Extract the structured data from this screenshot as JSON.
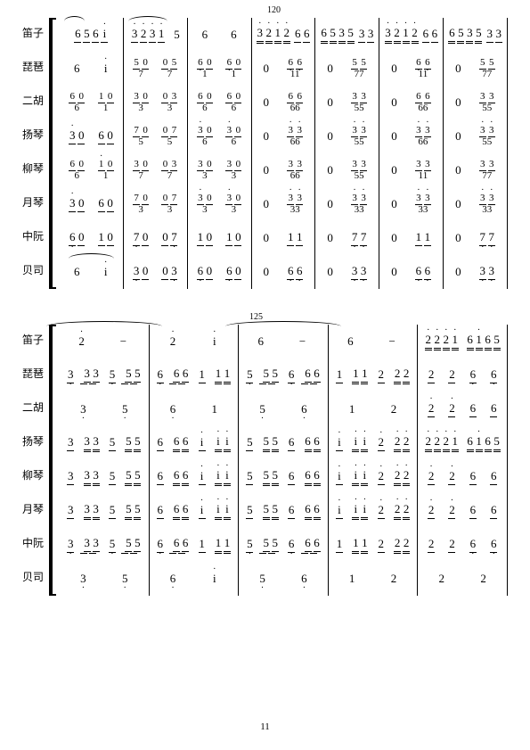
{
  "page_number": "11",
  "measure_numbers": {
    "sys1": "120",
    "sys2": "125"
  },
  "instruments": {
    "dizi": "笛子",
    "pipa": "琵琶",
    "erhu": "二胡",
    "yangqin": "扬琴",
    "liuqin": "柳琴",
    "yueqin": "月琴",
    "zhongruan": "中阮",
    "beisi": "贝司"
  },
  "system1": {
    "dizi": {
      "m1": [
        "6",
        "5",
        "6",
        "i"
      ],
      "m2": [
        "3",
        "2",
        "3",
        "1",
        "5"
      ],
      "m3": [
        "6",
        "6"
      ],
      "m4": [
        "3",
        "2",
        "1",
        "2",
        "6",
        "6"
      ],
      "m5": [
        "6",
        "5",
        "3",
        "5",
        "3",
        "3"
      ],
      "m6": [
        "3",
        "2",
        "1",
        "2",
        "6",
        "6"
      ],
      "m7": [
        "6",
        "5",
        "3",
        "5",
        "3",
        "3"
      ]
    },
    "pipa": {
      "m1": [
        "6",
        "i"
      ],
      "m2a": [
        "5",
        "0"
      ],
      "m2b": [
        "0",
        "5"
      ],
      "m2_low": [
        "7",
        "7"
      ],
      "m3a": [
        "6",
        "0"
      ],
      "m3b": [
        "6",
        "0"
      ],
      "m3_low": [
        "1",
        "1"
      ],
      "m4": [
        "0",
        "6",
        "6"
      ],
      "m4_low": [
        "1",
        "1"
      ],
      "m5": [
        "0",
        "5",
        "5"
      ],
      "m5_low": [
        "7",
        "7"
      ],
      "m6": [
        "0",
        "6",
        "6"
      ],
      "m6_low": [
        "1",
        "1"
      ],
      "m7": [
        "0",
        "5",
        "5"
      ],
      "m7_low": [
        "7",
        "7"
      ]
    },
    "erhu": {
      "m1a": [
        "6",
        "0"
      ],
      "m1b": [
        "1",
        "0"
      ],
      "m1_low": [
        "6",
        "1"
      ],
      "m2a": [
        "3",
        "0"
      ],
      "m2b": [
        "0",
        "3"
      ],
      "m2_low": [
        "3",
        "3"
      ],
      "m3a": [
        "6",
        "0"
      ],
      "m3b": [
        "6",
        "0"
      ],
      "m3_low": [
        "6",
        "6"
      ],
      "m4": [
        "0",
        "6",
        "6"
      ],
      "m4_low": [
        "6",
        "6"
      ],
      "m5": [
        "0",
        "3",
        "3"
      ],
      "m5_low": [
        "5",
        "5"
      ],
      "m6": [
        "0",
        "6",
        "6"
      ],
      "m6_low": [
        "6",
        "6"
      ],
      "m7": [
        "0",
        "3",
        "3"
      ],
      "m7_low": [
        "5",
        "5"
      ]
    },
    "yangqin": {
      "m1a": [
        "3",
        "0"
      ],
      "m1b": [
        "6",
        "0"
      ],
      "m2a": [
        "7",
        "0"
      ],
      "m2b": [
        "0",
        "7"
      ],
      "m2_low": [
        "5",
        "5"
      ],
      "m3a": [
        "3",
        "0"
      ],
      "m3b": [
        "3",
        "0"
      ],
      "m3_low": [
        "6",
        "6"
      ],
      "m4": [
        "0",
        "3",
        "3"
      ],
      "m4_low": [
        "6",
        "6"
      ],
      "m5": [
        "0",
        "3",
        "3"
      ],
      "m5_low": [
        "5",
        "5"
      ],
      "m6": [
        "0",
        "3",
        "3"
      ],
      "m6_low": [
        "6",
        "6"
      ],
      "m7": [
        "0",
        "3",
        "3"
      ],
      "m7_low": [
        "5",
        "5"
      ]
    },
    "liuqin": {
      "m1a": [
        "6",
        "0"
      ],
      "m1b": [
        "1",
        "0"
      ],
      "m1_low": [
        "6",
        "1"
      ],
      "m2a": [
        "3",
        "0"
      ],
      "m2b": [
        "0",
        "3"
      ],
      "m2_low": [
        "7",
        "7"
      ],
      "m3a": [
        "3",
        "0"
      ],
      "m3b": [
        "3",
        "0"
      ],
      "m3_low": [
        "3",
        "3"
      ],
      "m4": [
        "0",
        "3",
        "3"
      ],
      "m4_low": [
        "6",
        "6"
      ],
      "m5": [
        "0",
        "3",
        "3"
      ],
      "m5_low": [
        "5",
        "5"
      ],
      "m6": [
        "0",
        "3",
        "3"
      ],
      "m6_low": [
        "1",
        "1"
      ],
      "m7": [
        "0",
        "3",
        "3"
      ],
      "m7_low": [
        "7",
        "7"
      ]
    },
    "yueqin": {
      "m1a": [
        "3",
        "0"
      ],
      "m1b": [
        "6",
        "0"
      ],
      "m2a": [
        "7",
        "0"
      ],
      "m2b": [
        "0",
        "7"
      ],
      "m2_low": [
        "3",
        "3"
      ],
      "m3a": [
        "3",
        "0"
      ],
      "m3b": [
        "3",
        "0"
      ],
      "m3_low": [
        "3",
        "3"
      ],
      "m4": [
        "0",
        "3",
        "3"
      ],
      "m4_low": [
        "3",
        "3"
      ],
      "m5": [
        "0",
        "3",
        "3"
      ],
      "m5_low": [
        "3",
        "3"
      ],
      "m6": [
        "0",
        "3",
        "3"
      ],
      "m6_low": [
        "3",
        "3"
      ],
      "m7": [
        "0",
        "3",
        "3"
      ],
      "m7_low": [
        "3",
        "3"
      ]
    },
    "zhongruan": {
      "m1a": [
        "6",
        "0"
      ],
      "m1b": [
        "1",
        "0"
      ],
      "m2a": [
        "7",
        "0"
      ],
      "m2b": [
        "0",
        "7"
      ],
      "m3a": [
        "1",
        "0"
      ],
      "m3b": [
        "1",
        "0"
      ],
      "m4": [
        "0",
        "1",
        "1"
      ],
      "m5": [
        "0",
        "7",
        "7"
      ],
      "m6": [
        "0",
        "1",
        "1"
      ],
      "m7": [
        "0",
        "7",
        "7"
      ]
    },
    "beisi": {
      "m1": [
        "6",
        "i"
      ],
      "m2a": [
        "3",
        "0"
      ],
      "m2b": [
        "0",
        "3"
      ],
      "m3a": [
        "6",
        "0"
      ],
      "m3b": [
        "6",
        "0"
      ],
      "m4": [
        "0",
        "6",
        "6"
      ],
      "m5": [
        "0",
        "3",
        "3"
      ],
      "m6": [
        "0",
        "6",
        "6"
      ],
      "m7": [
        "0",
        "3",
        "3"
      ]
    }
  },
  "system2": {
    "dizi": {
      "m1": [
        "2",
        "−"
      ],
      "m2": [
        "2",
        "i"
      ],
      "m3": [
        "6",
        "−"
      ],
      "m4": [
        "6",
        "−"
      ],
      "m5": [
        "2",
        "2",
        "2",
        "1",
        "6",
        "1",
        "6",
        "5"
      ]
    },
    "pipa": {
      "m1": [
        "3",
        "3",
        "3",
        "5",
        "5",
        "5"
      ],
      "m2": [
        "6",
        "6",
        "6",
        "1",
        "1",
        "1"
      ],
      "m3": [
        "5",
        "5",
        "5",
        "6",
        "6",
        "6"
      ],
      "m4": [
        "1",
        "1",
        "1",
        "2",
        "2",
        "2"
      ],
      "m5": [
        "2",
        "2",
        "6",
        "6"
      ]
    },
    "erhu": {
      "m1": [
        "3",
        "5"
      ],
      "m2": [
        "6",
        "1"
      ],
      "m3": [
        "5",
        "6"
      ],
      "m4": [
        "1",
        "2"
      ],
      "m5": [
        "2",
        "2",
        "6",
        "6"
      ]
    },
    "yangqin": {
      "m1": [
        "3",
        "3",
        "3",
        "5",
        "5",
        "5"
      ],
      "m2": [
        "6",
        "6",
        "6",
        "i",
        "i",
        "i"
      ],
      "m3": [
        "5",
        "5",
        "5",
        "6",
        "6",
        "6"
      ],
      "m4": [
        "i",
        "i",
        "i",
        "2",
        "2",
        "2"
      ],
      "m5": [
        "2",
        "2",
        "2",
        "1",
        "6",
        "1",
        "6",
        "5"
      ]
    },
    "liuqin": {
      "m1": [
        "3",
        "3",
        "3",
        "5",
        "5",
        "5"
      ],
      "m2": [
        "6",
        "6",
        "6",
        "i",
        "i",
        "i"
      ],
      "m3": [
        "5",
        "5",
        "5",
        "6",
        "6",
        "6"
      ],
      "m4": [
        "i",
        "i",
        "i",
        "2",
        "2",
        "2"
      ],
      "m5": [
        "2",
        "2",
        "6",
        "6"
      ]
    },
    "yueqin": {
      "m1": [
        "3",
        "3",
        "3",
        "5",
        "5",
        "5"
      ],
      "m2": [
        "6",
        "6",
        "6",
        "i",
        "i",
        "i"
      ],
      "m3": [
        "5",
        "5",
        "5",
        "6",
        "6",
        "6"
      ],
      "m4": [
        "i",
        "i",
        "i",
        "2",
        "2",
        "2"
      ],
      "m5": [
        "2",
        "2",
        "6",
        "6"
      ]
    },
    "zhongruan": {
      "m1": [
        "3",
        "3",
        "3",
        "5",
        "5",
        "5"
      ],
      "m2": [
        "6",
        "6",
        "6",
        "1",
        "1",
        "1"
      ],
      "m3": [
        "5",
        "5",
        "5",
        "6",
        "6",
        "6"
      ],
      "m4": [
        "1",
        "1",
        "1",
        "2",
        "2",
        "2"
      ],
      "m5": [
        "2",
        "2",
        "6",
        "6"
      ]
    },
    "beisi": {
      "m1": [
        "3",
        "5"
      ],
      "m2": [
        "6",
        "i"
      ],
      "m3": [
        "5",
        "6"
      ],
      "m4": [
        "1",
        "2"
      ],
      "m5": [
        "2",
        "2"
      ]
    }
  }
}
